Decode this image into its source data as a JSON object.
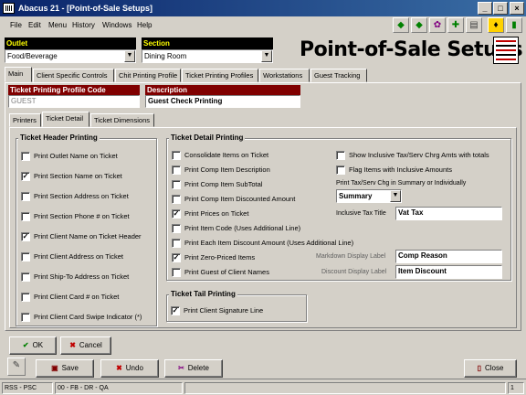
{
  "window": {
    "title": "Abacus 21 - [Point-of-Sale Setups]"
  },
  "menu": [
    "File",
    "Edit",
    "Menu",
    "History",
    "Windows",
    "Help"
  ],
  "header": {
    "outlet_label": "Outlet",
    "outlet_value": "Food/Beverage",
    "section_label": "Section",
    "section_value": "Dining Room",
    "page_title": "Point-of-Sale Setups"
  },
  "main_tabs": [
    "Main",
    "Client Specific Controls",
    "Chit Printing Profile",
    "Ticket Printing Profiles",
    "Workstations",
    "Guest Tracking"
  ],
  "profile": {
    "code_label": "Ticket Printing Profile Code",
    "code_value": "GUEST",
    "desc_label": "Description",
    "desc_value": "Guest Check Printing"
  },
  "sub_tabs": [
    "Printers",
    "Ticket Detail",
    "Ticket Dimensions"
  ],
  "ticket_header": {
    "title": "Ticket Header Printing",
    "items": [
      {
        "label": "Print Outlet Name on Ticket",
        "checked": false
      },
      {
        "label": "Print Section Name on Ticket",
        "checked": true
      },
      {
        "label": "Print Section Address on Ticket",
        "checked": false
      },
      {
        "label": "Print Section Phone # on Ticket",
        "checked": false
      },
      {
        "label": "Print Client Name on Ticket Header",
        "checked": true
      },
      {
        "label": "Print Client Address on Ticket",
        "checked": false
      },
      {
        "label": "Print Ship-To Address on Ticket",
        "checked": false
      },
      {
        "label": "Print Client Card # on Ticket",
        "checked": false
      },
      {
        "label": "Print Client Card Swipe Indicator (*)",
        "checked": false
      }
    ]
  },
  "ticket_detail": {
    "title": "Ticket Detail Printing",
    "items": [
      {
        "label": "Consolidate Items on Ticket",
        "checked": false
      },
      {
        "label": "Print Comp Item Description",
        "checked": false
      },
      {
        "label": "Print Comp Item SubTotal",
        "checked": false
      },
      {
        "label": "Print Comp Item Discounted Amount",
        "checked": false
      },
      {
        "label": "Print Prices on Ticket",
        "checked": true
      },
      {
        "label": "Print Item Code (Uses Additional Line)",
        "checked": false
      },
      {
        "label": "Print Each Item Discount Amount (Uses Additional Line)",
        "checked": false
      },
      {
        "label": "Print Zero-Priced Items",
        "checked": true
      },
      {
        "label": "Print Guest of Client Names",
        "checked": false
      }
    ],
    "right_items": [
      {
        "label": "Show Inclusive Tax/Serv Chrg Amts with totals",
        "checked": false
      },
      {
        "label": "Flag Items with Inclusive Amounts",
        "checked": false
      }
    ],
    "tax_chg_label": "Print Tax/Serv Chg in Summary or Individually",
    "tax_chg_value": "Summary",
    "inclusive_tax_label": "Inclusive Tax Title",
    "inclusive_tax_value": "Vat Tax",
    "markdown_label": "Markdown Display Label",
    "markdown_value": "Comp Reason",
    "discount_label": "Discount Display Label",
    "discount_value": "Item Discount"
  },
  "ticket_tail": {
    "title": "Ticket Tail Printing",
    "items": [
      {
        "label": "Print Client Signature Line",
        "checked": true
      }
    ]
  },
  "dialog_buttons": {
    "ok": "OK",
    "cancel": "Cancel"
  },
  "toolbar_buttons": {
    "save": "Save",
    "undo": "Undo",
    "delete": "Delete",
    "close": "Close"
  },
  "status": {
    "left": "RSS - PSC",
    "middle": "00 - FB - DR - QA",
    "right": "1"
  },
  "colors": {
    "title_bar": "#0a246a",
    "label_bg": "#000000",
    "label_text": "#ffff00",
    "profile_label_bg": "#800000"
  }
}
